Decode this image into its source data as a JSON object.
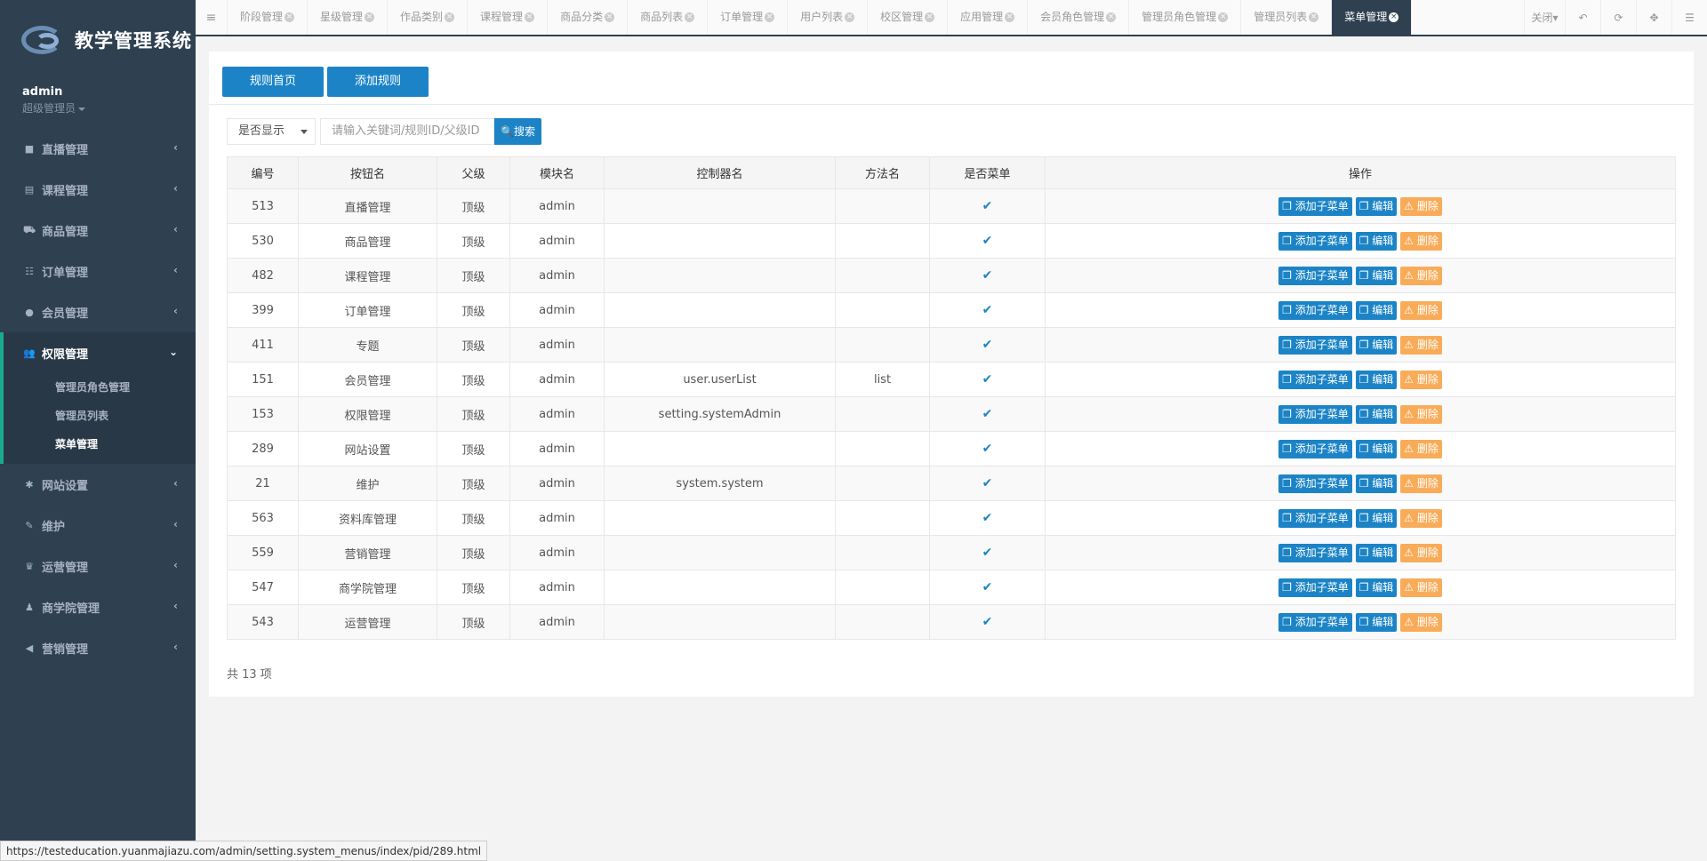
{
  "brand": {
    "title": "教学管理系统"
  },
  "user": {
    "name": "admin",
    "role": "超级管理员"
  },
  "sidebar": {
    "items": [
      {
        "label": "直播管理",
        "icon": "video-icon"
      },
      {
        "label": "课程管理",
        "icon": "book-icon"
      },
      {
        "label": "商品管理",
        "icon": "cart-icon"
      },
      {
        "label": "订单管理",
        "icon": "list-icon"
      },
      {
        "label": "会员管理",
        "icon": "user-icon"
      }
    ],
    "active_group": {
      "label": "权限管理",
      "icon": "users-icon",
      "children": [
        "管理员角色管理",
        "管理员列表",
        "菜单管理"
      ]
    },
    "items_after": [
      {
        "label": "网站设置",
        "icon": "gear-icon"
      },
      {
        "label": "维护",
        "icon": "wrench-icon"
      },
      {
        "label": "运营管理",
        "icon": "trophy-icon"
      },
      {
        "label": "商学院管理",
        "icon": "group-icon"
      },
      {
        "label": "营销管理",
        "icon": "bullhorn-icon"
      }
    ]
  },
  "tabs": [
    "阶段管理",
    "星级管理",
    "作品类别",
    "课程管理",
    "商品分类",
    "商品列表",
    "订单管理",
    "用户列表",
    "校区管理",
    "应用管理",
    "会员角色管理",
    "管理员角色管理",
    "管理员列表",
    "菜单管理"
  ],
  "tab_tools": {
    "close_label": "关闭"
  },
  "toolbar": {
    "home_label": "规则首页",
    "add_label": "添加规则"
  },
  "filter": {
    "select_value": "是否显示",
    "search_placeholder": "请输入关键词/规则ID/父级ID",
    "search_label": "搜索"
  },
  "table": {
    "headers": [
      "编号",
      "按钮名",
      "父级",
      "模块名",
      "控制器名",
      "方法名",
      "是否菜单",
      "操作"
    ],
    "rows": [
      {
        "id": "513",
        "name": "直播管理",
        "parent": "顶级",
        "module": "admin",
        "controller": "",
        "method": ""
      },
      {
        "id": "530",
        "name": "商品管理",
        "parent": "顶级",
        "module": "admin",
        "controller": "",
        "method": ""
      },
      {
        "id": "482",
        "name": "课程管理",
        "parent": "顶级",
        "module": "admin",
        "controller": "",
        "method": ""
      },
      {
        "id": "399",
        "name": "订单管理",
        "parent": "顶级",
        "module": "admin",
        "controller": "",
        "method": ""
      },
      {
        "id": "411",
        "name": "专题",
        "parent": "顶级",
        "module": "admin",
        "controller": "",
        "method": ""
      },
      {
        "id": "151",
        "name": "会员管理",
        "parent": "顶级",
        "module": "admin",
        "controller": "user.userList",
        "method": "list"
      },
      {
        "id": "153",
        "name": "权限管理",
        "parent": "顶级",
        "module": "admin",
        "controller": "setting.systemAdmin",
        "method": ""
      },
      {
        "id": "289",
        "name": "网站设置",
        "parent": "顶级",
        "module": "admin",
        "controller": "",
        "method": ""
      },
      {
        "id": "21",
        "name": "维护",
        "parent": "顶级",
        "module": "admin",
        "controller": "system.system",
        "method": ""
      },
      {
        "id": "563",
        "name": "资料库管理",
        "parent": "顶级",
        "module": "admin",
        "controller": "",
        "method": ""
      },
      {
        "id": "559",
        "name": "营销管理",
        "parent": "顶级",
        "module": "admin",
        "controller": "",
        "method": ""
      },
      {
        "id": "547",
        "name": "商学院管理",
        "parent": "顶级",
        "module": "admin",
        "controller": "",
        "method": ""
      },
      {
        "id": "543",
        "name": "运营管理",
        "parent": "顶级",
        "module": "admin",
        "controller": "",
        "method": ""
      }
    ],
    "actions": {
      "add_child": "添加子菜单",
      "edit": "编辑",
      "delete": "删除"
    }
  },
  "total_text": "共 13 项",
  "status_url": "https://testeducation.yuanmajiazu.com/admin/setting.system_menus/index/pid/289.html"
}
